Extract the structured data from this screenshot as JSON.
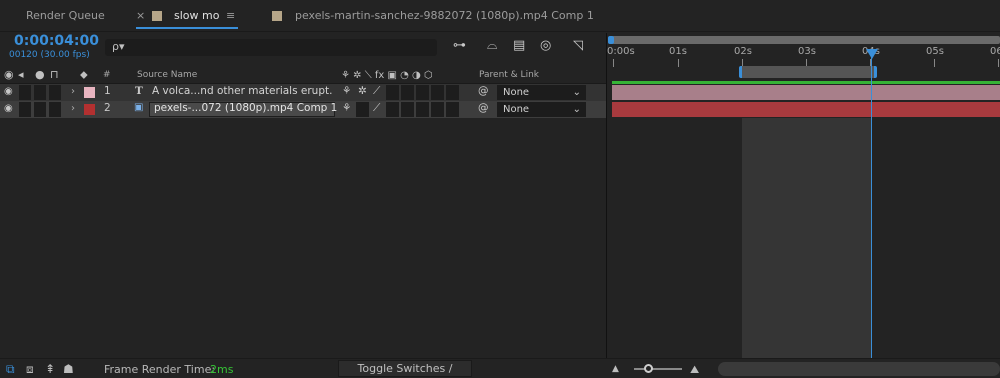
{
  "tabs": {
    "render_queue": "Render Queue",
    "close": "×",
    "active_tab": "slow mo",
    "menu": "≡",
    "comp_tab": "pexels-martin-sanchez-9882072 (1080p).mp4 Comp 1"
  },
  "time": {
    "timecode": "0:00:04:00",
    "frames": "00120 (30.00 fps)"
  },
  "search": {
    "placeholder": "",
    "icon": "ρ▾"
  },
  "columns": {
    "hash": "#",
    "source_name": "Source Name",
    "switch_icons": "⚘ ✲ ⟍ fx ▣ ◔ ◑ ⬡",
    "parent_link": "Parent & Link"
  },
  "layers": [
    {
      "index": "1",
      "type_glyph": "T",
      "name": "A volca...nd other materials erupt.",
      "label_color": "#e8b4c0",
      "parent": "None"
    },
    {
      "index": "2",
      "type_glyph": "▣",
      "name": "pexels-...072 (1080p).mp4 Comp 1",
      "label_color": "#b33030",
      "parent": "None"
    }
  ],
  "ruler": {
    "labels": [
      "0:00s",
      "01s",
      "02s",
      "03s",
      "04s",
      "05s",
      "06"
    ]
  },
  "bottom": {
    "frame_render_label": "Frame Render Time:",
    "frame_render_value": "2ms",
    "toggle_label": "Toggle Switches / Modes"
  },
  "colors": {
    "accent": "#3a8fd9",
    "layer1_bar": "#a87f8a",
    "layer2_bar": "#a83a3e",
    "work_area_green": "#36b336"
  }
}
